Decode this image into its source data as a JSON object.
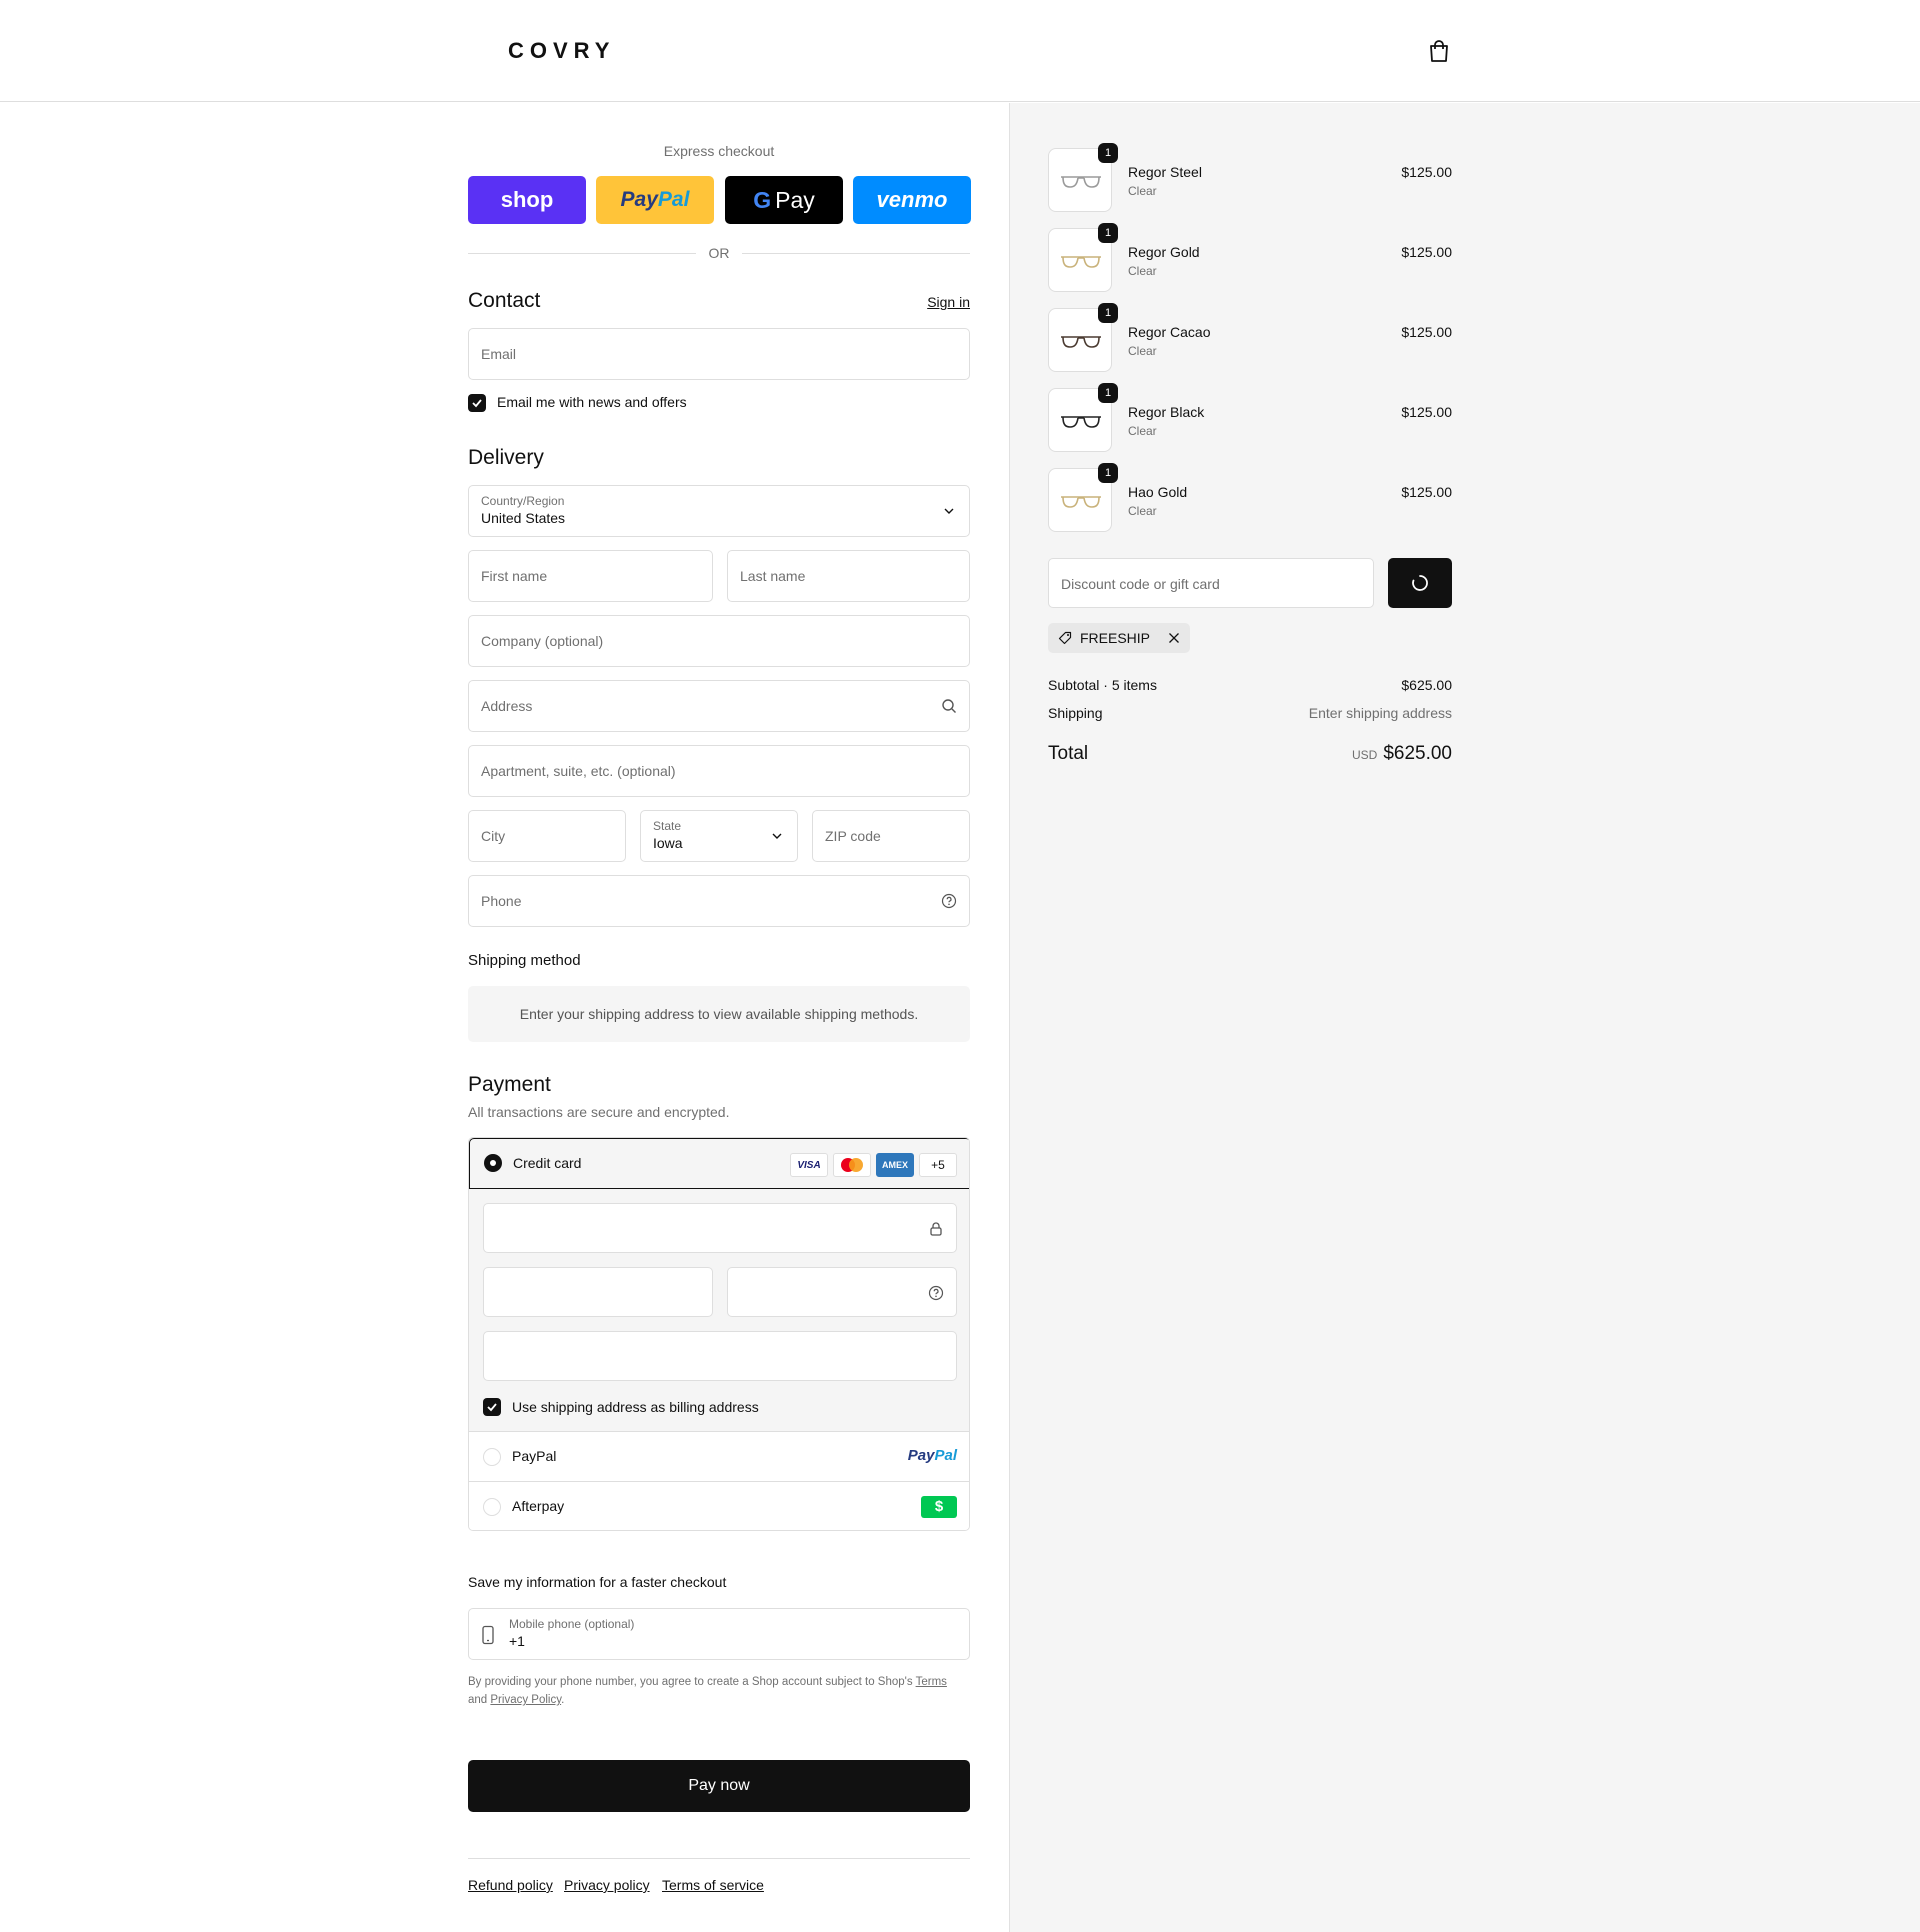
{
  "header": {
    "logo": "COVRY",
    "cart_icon": "shopping-bag-icon"
  },
  "express": {
    "title": "Express checkout",
    "shop": "shop",
    "paypal_a": "Pay",
    "paypal_b": "Pal",
    "gpay_g": "G",
    "gpay": "Pay",
    "venmo": "venmo",
    "or": "OR"
  },
  "contact": {
    "title": "Contact",
    "sign_in": "Sign in",
    "email_placeholder": "Email",
    "news_label": "Email me with news and offers",
    "news_checked": true
  },
  "delivery": {
    "title": "Delivery",
    "country_label": "Country/Region",
    "country_value": "United States",
    "first_name": "First name",
    "last_name": "Last name",
    "company": "Company (optional)",
    "address": "Address",
    "apartment": "Apartment, suite, etc. (optional)",
    "city": "City",
    "state_label": "State",
    "state_value": "Iowa",
    "zip": "ZIP code",
    "phone": "Phone"
  },
  "shipping": {
    "title": "Shipping method",
    "note": "Enter your shipping address to view available shipping methods."
  },
  "payment": {
    "title": "Payment",
    "subtitle": "All transactions are secure and encrypted.",
    "credit_card": "Credit card",
    "card_logos": [
      "VISA",
      "",
      "AMEX",
      "+5"
    ],
    "billing_label": "Use shipping address as billing address",
    "paypal": "PayPal",
    "paypal_logo_a": "Pay",
    "paypal_logo_b": "Pal",
    "afterpay": "Afterpay",
    "afterpay_logo": "$"
  },
  "save": {
    "title": "Save my information for a faster checkout",
    "mobile_label": "Mobile phone (optional)",
    "mobile_value": "+1",
    "legal_a": "By providing your phone number, you agree to create a Shop account subject to Shop's ",
    "terms": "Terms",
    "legal_b": "and ",
    "privacy": "Privacy Policy",
    "legal_c": "."
  },
  "pay_now": "Pay now",
  "footer": {
    "refund": "Refund policy",
    "privacy": "Privacy policy",
    "terms": "Terms of service"
  },
  "items": [
    {
      "qty": "1",
      "name": "Regor Steel",
      "variant": "Clear",
      "price": "$125.00",
      "frame_color": "#9a9a9a"
    },
    {
      "qty": "1",
      "name": "Regor Gold",
      "variant": "Clear",
      "price": "$125.00",
      "frame_color": "#c9b27a"
    },
    {
      "qty": "1",
      "name": "Regor Cacao",
      "variant": "Clear",
      "price": "$125.00",
      "frame_color": "#4a3a30"
    },
    {
      "qty": "1",
      "name": "Regor Black",
      "variant": "Clear",
      "price": "$125.00",
      "frame_color": "#222222"
    },
    {
      "qty": "1",
      "name": "Hao Gold",
      "variant": "Clear",
      "price": "$125.00",
      "frame_color": "#c9b27a"
    }
  ],
  "summary": {
    "discount_placeholder": "Discount code or gift card",
    "code": "FREESHIP",
    "subtotal_label": "Subtotal · 5 items",
    "subtotal": "$625.00",
    "shipping_label": "Shipping",
    "shipping_value": "Enter shipping address",
    "total_label": "Total",
    "currency": "USD",
    "total": "$625.00"
  },
  "colors": {
    "shop": "#5a31f4",
    "paypal": "#ffc439",
    "venmo": "#008cff",
    "afterpay": "#00c853"
  }
}
